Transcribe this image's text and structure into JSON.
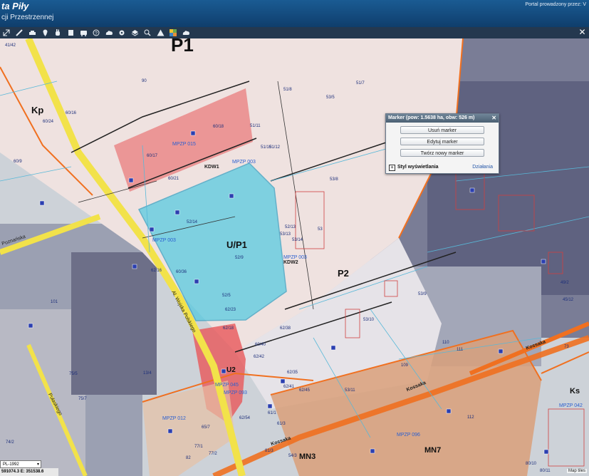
{
  "header": {
    "title": "ta Piły",
    "subtitle": "cji Przestrzennej",
    "portal_text": "Portal prowadzony przez: V"
  },
  "toolbar": {
    "icons": [
      "resize-icon",
      "measure-icon",
      "car-icon",
      "pin-icon",
      "hand-icon",
      "document-icon",
      "bus-icon",
      "help-icon",
      "cloud-upload-icon",
      "settings-icon",
      "layers-icon",
      "zoom-icon",
      "warning-icon",
      "color-grid-icon",
      "cloud-icon"
    ],
    "close_glyph": "✕"
  },
  "map": {
    "zones": [
      "P1",
      "Kp",
      "U/P1",
      "P2",
      "U2",
      "MN3",
      "MN7",
      "Ks",
      "KDW1",
      "KDW2"
    ],
    "plots": [
      "41/42",
      "90",
      "60/24",
      "60/16",
      "60/17",
      "60/18",
      "60/21",
      "60/9",
      "52/14",
      "52/9",
      "51/8",
      "53/13",
      "53/8",
      "53/5",
      "53/9",
      "53/10",
      "53/11",
      "52/5",
      "53",
      "51/10",
      "51/11",
      "51/12",
      "51/7",
      "101",
      "109",
      "110",
      "111",
      "112",
      "62/16",
      "62/18",
      "62/23",
      "62/35",
      "62/41",
      "62/38",
      "62/45",
      "62/54",
      "65/7",
      "82",
      "45/12",
      "49/2",
      "73",
      "75/5",
      "75/7",
      "13/4",
      "74/2",
      "60/40",
      "60/36",
      "54/3",
      "62/42",
      "61/1",
      "61/3",
      "77/1",
      "77/2",
      "81/3",
      "52/13",
      "53/14",
      "80/10",
      "80/11"
    ],
    "mpzp_labels": [
      "MPZP 015",
      "MPZP 003",
      "MPZP 003",
      "MPZP 003",
      "MPZP 045",
      "MPZP 093",
      "MPZP 096",
      "MPZP 042",
      "MPZP 012"
    ],
    "streets": [
      "Kossaka",
      "Kossaka",
      "Kossaka",
      "Al. Wojska Polskiego",
      "Poznańska",
      "Pułaskiego"
    ],
    "copyright": "Map tiles"
  },
  "popup": {
    "title": "Marker (pow: 1.5638 ha, obw: 526 m)",
    "close": "✕",
    "buttons": {
      "delete": "Usuń marker",
      "edit": "Edytuj marker",
      "create": "Twórz nowy marker"
    },
    "footer_expand": "+",
    "footer_label": "Styl wyświetlania",
    "footer_action": "Działania"
  },
  "status": {
    "crs": "PL-1992",
    "crs_arrow": "▾",
    "coords": "591074.3  E: 351538.6"
  },
  "colors": {
    "header": "#1a5b93",
    "selection": "#4fc9e0",
    "zone_red": "#e8585a",
    "road_orange": "#f07020",
    "road_yellow": "#f2e24a"
  }
}
